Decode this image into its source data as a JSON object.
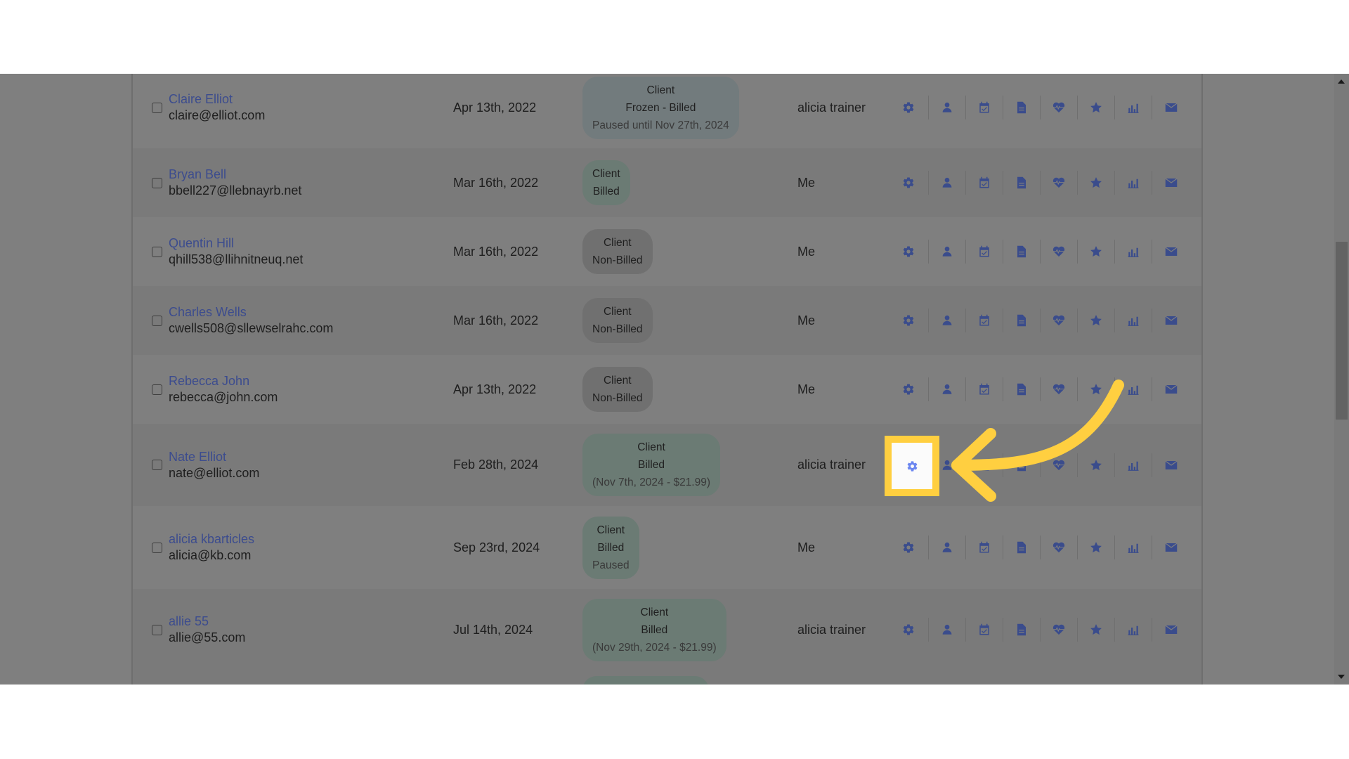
{
  "table": {
    "rows": [
      {
        "name": "Claire Elliot",
        "email": "claire@elliot.com",
        "date": "Apr 13th, 2022",
        "badge": {
          "style": "frozen",
          "line1": "Client",
          "line2": "Frozen - Billed",
          "line3": "Paused until Nov 27th, 2024"
        },
        "trainer": "alicia trainer"
      },
      {
        "name": "Bryan Bell",
        "email": "bbell227@llebnayrb.net",
        "date": "Mar 16th, 2022",
        "badge": {
          "style": "green",
          "line1": "Client",
          "line2": "Billed",
          "line3": ""
        },
        "trainer": "Me"
      },
      {
        "name": "Quentin Hill",
        "email": "qhill538@llihnitneuq.net",
        "date": "Mar 16th, 2022",
        "badge": {
          "style": "grey",
          "line1": "Client",
          "line2": "Non-Billed",
          "line3": ""
        },
        "trainer": "Me"
      },
      {
        "name": "Charles Wells",
        "email": "cwells508@sllewselrahc.com",
        "date": "Mar 16th, 2022",
        "badge": {
          "style": "grey",
          "line1": "Client",
          "line2": "Non-Billed",
          "line3": ""
        },
        "trainer": "Me"
      },
      {
        "name": "Rebecca John",
        "email": "rebecca@john.com",
        "date": "Apr 13th, 2022",
        "badge": {
          "style": "grey",
          "line1": "Client",
          "line2": "Non-Billed",
          "line3": ""
        },
        "trainer": "Me"
      },
      {
        "name": "Nate Elliot",
        "email": "nate@elliot.com",
        "date": "Feb 28th, 2024",
        "badge": {
          "style": "green",
          "line1": "Client",
          "line2": "Billed",
          "line3": "(Nov 7th, 2024 - $21.99)"
        },
        "trainer": "alicia trainer"
      },
      {
        "name": "alicia kbarticles",
        "email": "alicia@kb.com",
        "date": "Sep 23rd, 2024",
        "badge": {
          "style": "green",
          "line1": "Client",
          "line2": "Billed",
          "line3": "Paused"
        },
        "trainer": "Me"
      },
      {
        "name": "allie 55",
        "email": "allie@55.com",
        "date": "Jul 14th, 2024",
        "badge": {
          "style": "green",
          "line1": "Client",
          "line2": "Billed",
          "line3": "(Nov 29th, 2024 - $21.99)"
        },
        "trainer": "alicia trainer"
      }
    ],
    "action_icons": [
      "gear-icon",
      "user-icon",
      "calendar-check-icon",
      "file-icon",
      "heartbeat-icon",
      "star-icon",
      "bar-chart-icon",
      "envelope-icon"
    ]
  },
  "highlight": {
    "target": "settings gear of Nate Elliot row",
    "color": "#ffcf40"
  },
  "colors": {
    "link": "#3c4c8e",
    "icon": "#3a4c8c",
    "highlight_icon": "#6b86f0"
  }
}
